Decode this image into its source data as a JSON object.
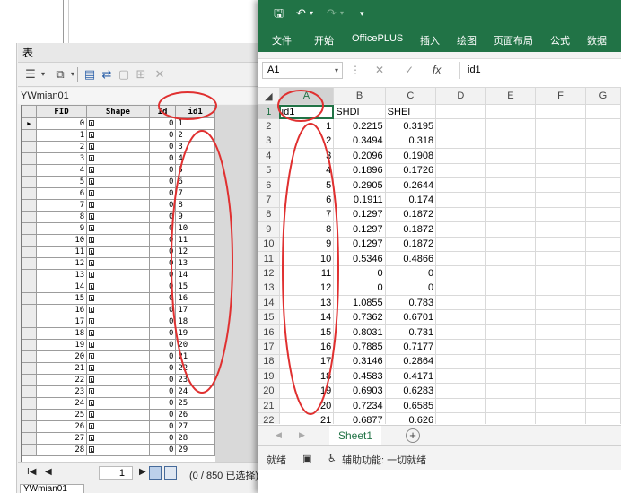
{
  "arcgis": {
    "window_title": "表",
    "table_name": "YWmian01",
    "columns": [
      "FID",
      "Shape",
      "Id",
      "id1"
    ],
    "shape_value": "面",
    "rows": [
      {
        "fid": "0",
        "id": "0",
        "id1": "1"
      },
      {
        "fid": "1",
        "id": "0",
        "id1": "2"
      },
      {
        "fid": "2",
        "id": "0",
        "id1": "3"
      },
      {
        "fid": "3",
        "id": "0",
        "id1": "4"
      },
      {
        "fid": "4",
        "id": "0",
        "id1": "5"
      },
      {
        "fid": "5",
        "id": "0",
        "id1": "6"
      },
      {
        "fid": "6",
        "id": "0",
        "id1": "7"
      },
      {
        "fid": "7",
        "id": "0",
        "id1": "8"
      },
      {
        "fid": "8",
        "id": "0",
        "id1": "9"
      },
      {
        "fid": "9",
        "id": "0",
        "id1": "10"
      },
      {
        "fid": "10",
        "id": "0",
        "id1": "11"
      },
      {
        "fid": "11",
        "id": "0",
        "id1": "12"
      },
      {
        "fid": "12",
        "id": "0",
        "id1": "13"
      },
      {
        "fid": "13",
        "id": "0",
        "id1": "14"
      },
      {
        "fid": "14",
        "id": "0",
        "id1": "15"
      },
      {
        "fid": "15",
        "id": "0",
        "id1": "16"
      },
      {
        "fid": "16",
        "id": "0",
        "id1": "17"
      },
      {
        "fid": "17",
        "id": "0",
        "id1": "18"
      },
      {
        "fid": "18",
        "id": "0",
        "id1": "19"
      },
      {
        "fid": "19",
        "id": "0",
        "id1": "20"
      },
      {
        "fid": "20",
        "id": "0",
        "id1": "21"
      },
      {
        "fid": "21",
        "id": "0",
        "id1": "22"
      },
      {
        "fid": "22",
        "id": "0",
        "id1": "23"
      },
      {
        "fid": "23",
        "id": "0",
        "id1": "24"
      },
      {
        "fid": "24",
        "id": "0",
        "id1": "25"
      },
      {
        "fid": "25",
        "id": "0",
        "id1": "26"
      },
      {
        "fid": "26",
        "id": "0",
        "id1": "27"
      },
      {
        "fid": "27",
        "id": "0",
        "id1": "28"
      },
      {
        "fid": "28",
        "id": "0",
        "id1": "29"
      }
    ],
    "current_record": "1",
    "selection_text": "(0 / 850 已选择)",
    "bottom_tab": "YWmian01",
    "toolbar_icons": [
      "table-options-icon",
      "related-tables-icon",
      "select-by-attributes-icon",
      "switch-selection-icon",
      "clear-selection-icon",
      "zoom-to-selected-icon",
      "delete-selected-icon"
    ]
  },
  "excel": {
    "ribbon_tabs": [
      "文件",
      "开始",
      "OfficePLUS",
      "插入",
      "绘图",
      "页面布局",
      "公式",
      "数据"
    ],
    "name_box": "A1",
    "formula_value": "id1",
    "columns": [
      "A",
      "B",
      "C",
      "D",
      "E",
      "F",
      "G"
    ],
    "header_row": [
      "id1",
      "SHDI",
      "SHEI"
    ],
    "rows": [
      {
        "r": "2",
        "a": "1",
        "b": "0.2215",
        "c": "0.3195"
      },
      {
        "r": "3",
        "a": "2",
        "b": "0.3494",
        "c": "0.318"
      },
      {
        "r": "4",
        "a": "3",
        "b": "0.2096",
        "c": "0.1908"
      },
      {
        "r": "5",
        "a": "4",
        "b": "0.1896",
        "c": "0.1726"
      },
      {
        "r": "6",
        "a": "5",
        "b": "0.2905",
        "c": "0.2644"
      },
      {
        "r": "7",
        "a": "6",
        "b": "0.1911",
        "c": "0.174"
      },
      {
        "r": "8",
        "a": "7",
        "b": "0.1297",
        "c": "0.1872"
      },
      {
        "r": "9",
        "a": "8",
        "b": "0.1297",
        "c": "0.1872"
      },
      {
        "r": "10",
        "a": "9",
        "b": "0.1297",
        "c": "0.1872"
      },
      {
        "r": "11",
        "a": "10",
        "b": "0.5346",
        "c": "0.4866"
      },
      {
        "r": "12",
        "a": "11",
        "b": "0",
        "c": "0"
      },
      {
        "r": "13",
        "a": "12",
        "b": "0",
        "c": "0"
      },
      {
        "r": "14",
        "a": "13",
        "b": "1.0855",
        "c": "0.783"
      },
      {
        "r": "15",
        "a": "14",
        "b": "0.7362",
        "c": "0.6701"
      },
      {
        "r": "16",
        "a": "15",
        "b": "0.8031",
        "c": "0.731"
      },
      {
        "r": "17",
        "a": "16",
        "b": "0.7885",
        "c": "0.7177"
      },
      {
        "r": "18",
        "a": "17",
        "b": "0.3146",
        "c": "0.2864"
      },
      {
        "r": "19",
        "a": "18",
        "b": "0.4583",
        "c": "0.4171"
      },
      {
        "r": "20",
        "a": "19",
        "b": "0.6903",
        "c": "0.6283"
      },
      {
        "r": "21",
        "a": "20",
        "b": "0.7234",
        "c": "0.6585"
      },
      {
        "r": "22",
        "a": "21",
        "b": "0.6877",
        "c": "0.626"
      }
    ],
    "sheet_tab": "Sheet1",
    "status_ready": "就绪",
    "status_accessibility": "辅助功能: 一切就绪",
    "accent_color": "#217346"
  },
  "annotation_color": "#e03030"
}
